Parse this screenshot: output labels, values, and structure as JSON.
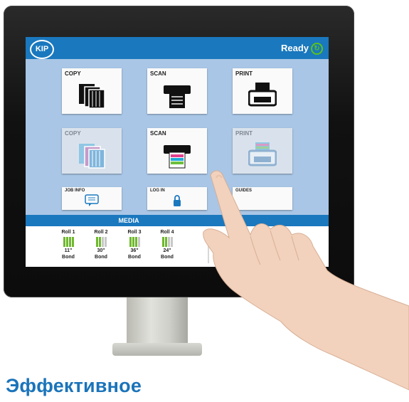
{
  "header": {
    "logo_text": "KIP",
    "status": "Ready",
    "status_icon": "refresh-icon",
    "accent": "#1a78be"
  },
  "tiles": [
    {
      "label": "COPY",
      "icon": "copy-icon"
    },
    {
      "label": "SCAN",
      "icon": "scan-icon"
    },
    {
      "label": "PRINT",
      "icon": "print-icon"
    },
    {
      "label": "COPY",
      "icon": "color-copy-icon",
      "disabled": true
    },
    {
      "label": "SCAN",
      "icon": "color-scan-icon"
    },
    {
      "label": "PRINT",
      "icon": "color-print-icon",
      "disabled": true
    }
  ],
  "small_tiles": [
    {
      "label": "JOB INFO",
      "icon": "chat-icon"
    },
    {
      "label": "LOG IN",
      "icon": "lock-icon"
    },
    {
      "label": "GUIDES",
      "icon": "help-icon"
    }
  ],
  "media": {
    "title": "MEDIA",
    "rolls": [
      {
        "name": "Roll 1",
        "size": "11\"",
        "type": "Bond",
        "level": 1.0
      },
      {
        "name": "Roll 2",
        "size": "30\"",
        "type": "Bond",
        "level": 0.5
      },
      {
        "name": "Roll 3",
        "size": "36\"",
        "type": "Bond",
        "level": 0.75
      },
      {
        "name": "Roll 4",
        "size": "24\"",
        "type": "Bond",
        "level": 0.5
      }
    ]
  },
  "headline": "Эффективное"
}
